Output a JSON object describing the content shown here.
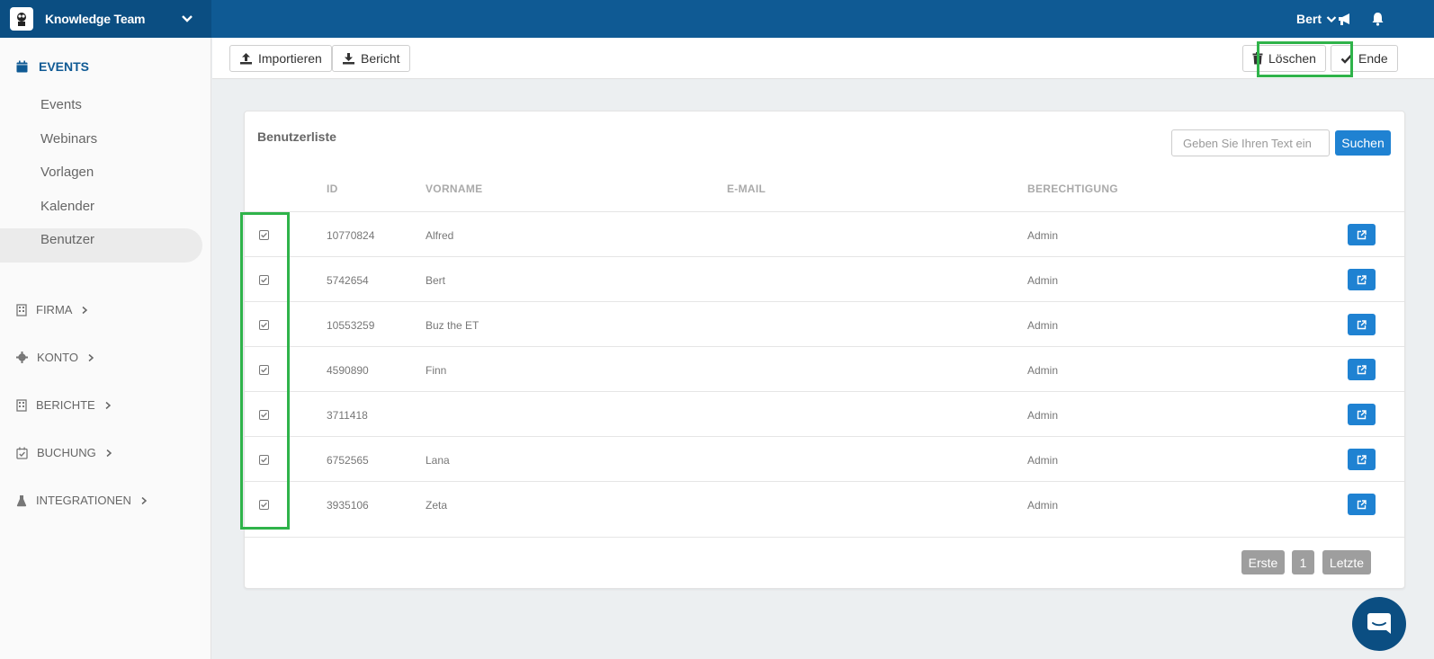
{
  "header": {
    "org_name": "Knowledge Team",
    "user_name": "Bert",
    "icons": [
      "org-logo",
      "chevron-down-icon",
      "megaphone-icon",
      "bell-icon"
    ]
  },
  "sidebar": {
    "events_label": "EVENTS",
    "event_items": [
      "Events",
      "Webinars",
      "Vorlagen",
      "Kalender",
      "Benutzer"
    ],
    "active_item": "Benutzer",
    "sections": [
      "FIRMA",
      "KONTO",
      "BERICHTE",
      "BUCHUNG",
      "INTEGRATIONEN"
    ]
  },
  "toolbar": {
    "import_label": "Importieren",
    "report_label": "Bericht",
    "delete_label": "Löschen",
    "done_label": "Ende"
  },
  "card": {
    "title": "Benutzerliste",
    "search_placeholder": "Geben Sie Ihren Text ein",
    "search_button": "Suchen"
  },
  "table": {
    "headers": [
      "ID",
      "VORNAME",
      "E-MAIL",
      "BERECHTIGUNG"
    ],
    "rows": [
      {
        "id": "10770824",
        "first_name": "Alfred",
        "email": "",
        "permission": "Admin",
        "checked": true
      },
      {
        "id": "5742654",
        "first_name": "Bert",
        "email": "",
        "permission": "Admin",
        "checked": true
      },
      {
        "id": "10553259",
        "first_name": "Buz the ET",
        "email": "",
        "permission": "Admin",
        "checked": true
      },
      {
        "id": "4590890",
        "first_name": "Finn",
        "email": "",
        "permission": "Admin",
        "checked": true
      },
      {
        "id": "3711418",
        "first_name": "",
        "email": "",
        "permission": "Admin",
        "checked": true
      },
      {
        "id": "6752565",
        "first_name": "Lana",
        "email": "",
        "permission": "Admin",
        "checked": true
      },
      {
        "id": "3935106",
        "first_name": "Zeta",
        "email": "",
        "permission": "Admin",
        "checked": true
      }
    ]
  },
  "pagination": {
    "first": "Erste",
    "page": "1",
    "last": "Letzte"
  },
  "colors": {
    "header_bg": "#0f5a94",
    "accent_blue": "#1f82d2",
    "highlight_green": "#2fb34a"
  }
}
